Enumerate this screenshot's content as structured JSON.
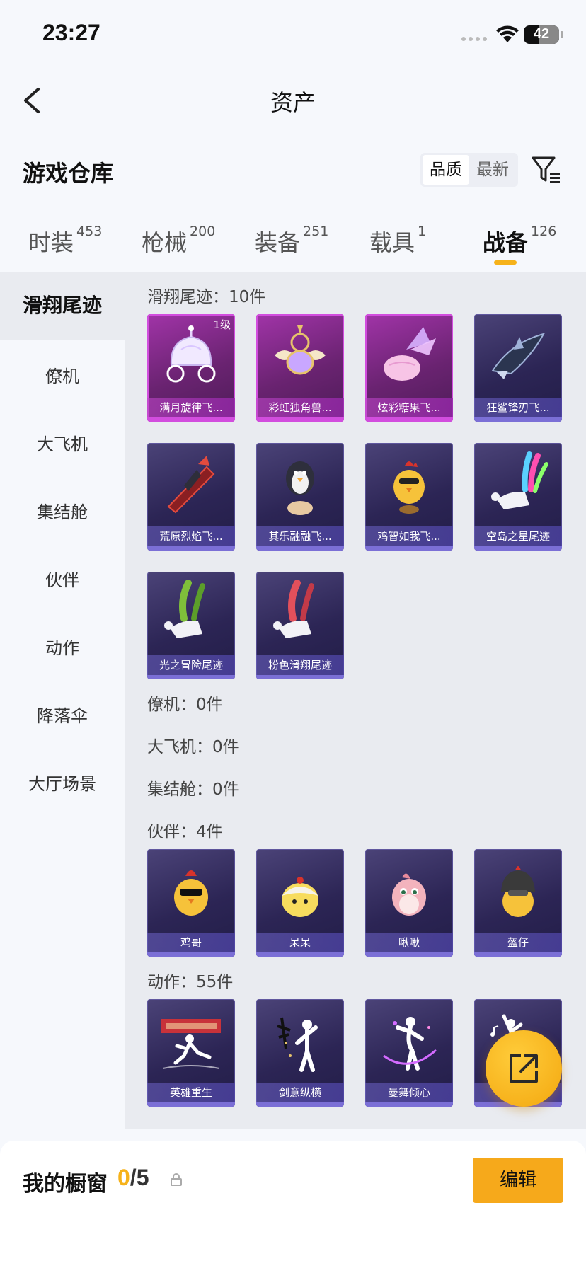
{
  "status": {
    "time": "23:27",
    "battery": "42",
    "battery_level": 0.42
  },
  "nav": {
    "title": "资产"
  },
  "warehouse": {
    "title": "游戏仓库",
    "sort_quality": "品质",
    "sort_newest": "最新",
    "sort_active": "品质"
  },
  "tabs": [
    {
      "label": "时装",
      "count": "453"
    },
    {
      "label": "枪械",
      "count": "200"
    },
    {
      "label": "装备",
      "count": "251"
    },
    {
      "label": "载具",
      "count": "1"
    },
    {
      "label": "战备",
      "count": "126",
      "active": true
    }
  ],
  "sidebar": [
    {
      "label": "滑翔尾迹",
      "active": true
    },
    {
      "label": "僚机"
    },
    {
      "label": "大飞机"
    },
    {
      "label": "集结舱"
    },
    {
      "label": "伙伴"
    },
    {
      "label": "动作"
    },
    {
      "label": "降落伞"
    },
    {
      "label": "大厅场景"
    }
  ],
  "sections": {
    "glide": {
      "header": "滑翔尾迹：10件",
      "items": [
        {
          "name": "满月旋律飞...",
          "badge": "1级",
          "rarity": "pink",
          "icon": "carriage-icon"
        },
        {
          "name": "彩虹独角兽...",
          "rarity": "pink",
          "icon": "unicorn-glider-icon"
        },
        {
          "name": "炫彩糖果飞...",
          "rarity": "pink",
          "icon": "candy-glider-icon"
        },
        {
          "name": "狂鲨锋刃飞...",
          "rarity": "purple",
          "icon": "shark-icon"
        },
        {
          "name": "荒原烈焰飞...",
          "rarity": "purple",
          "icon": "flame-glider-icon"
        },
        {
          "name": "其乐融融飞...",
          "rarity": "purple",
          "icon": "penguin-icon"
        },
        {
          "name": "鸡智如我飞...",
          "rarity": "purple",
          "icon": "chicken-glider-icon"
        },
        {
          "name": "空岛之星尾迹",
          "rarity": "purple",
          "icon": "rainbow-trail-icon"
        },
        {
          "name": "光之冒险尾迹",
          "rarity": "purple",
          "icon": "green-trail-icon"
        },
        {
          "name": "粉色滑翔尾迹",
          "rarity": "purple",
          "icon": "pink-trail-icon"
        }
      ]
    },
    "wingman": {
      "header": "僚机：0件"
    },
    "plane": {
      "header": "大飞机：0件"
    },
    "pod": {
      "header": "集结舱：0件"
    },
    "partner": {
      "header": "伙伴：4件",
      "items": [
        {
          "name": "鸡哥",
          "icon": "chicken-sunglasses-icon"
        },
        {
          "name": "呆呆",
          "icon": "chick-icon"
        },
        {
          "name": "啾啾",
          "icon": "bird-icon"
        },
        {
          "name": "盔仔",
          "icon": "helmet-chick-icon"
        }
      ]
    },
    "emote": {
      "header": "动作：55件",
      "items": [
        {
          "name": "英雄重生",
          "icon": "hero-pose-icon"
        },
        {
          "name": "剑意纵横",
          "icon": "sword-pose-icon"
        },
        {
          "name": "曼舞倾心",
          "icon": "dance-pose-icon"
        },
        {
          "name": "",
          "icon": "music-pose-icon"
        }
      ]
    }
  },
  "showcase": {
    "label": "我的橱窗",
    "current": "0",
    "separator": "/",
    "total": "5",
    "edit": "编辑"
  },
  "colors": {
    "accent": "#f6b21a",
    "pink_rarity": "#d24dde",
    "purple_rarity": "#7b6fd6"
  }
}
